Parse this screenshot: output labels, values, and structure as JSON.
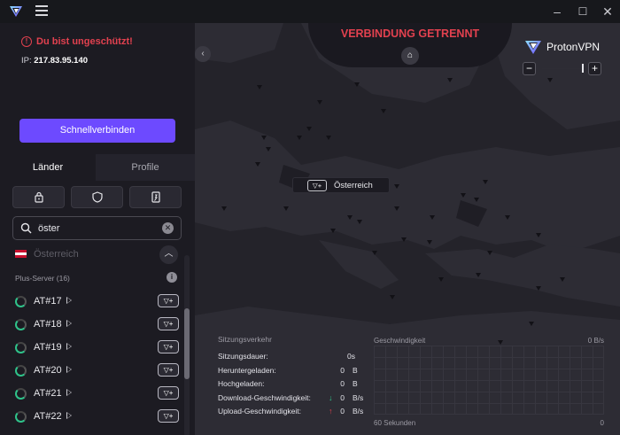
{
  "window": {
    "minimize": "–",
    "maximize": "☐",
    "close": "✕"
  },
  "status": {
    "text": "Du bist ungeschützt!",
    "ip_label": "IP:",
    "ip": "217.83.95.140",
    "color": "#e2414f"
  },
  "quick_connect": "Schnellverbinden",
  "tabs": [
    {
      "label": "Länder",
      "active": true
    },
    {
      "label": "Profile",
      "active": false
    }
  ],
  "filters": [
    "secure-core-filter-icon",
    "shield-filter-icon",
    "p2p-filter-icon"
  ],
  "search": {
    "value": "öster",
    "clear": "✕"
  },
  "country": {
    "name": "Österreich",
    "flag": [
      "#c8102e",
      "#ffffff",
      "#c8102e"
    ]
  },
  "plus_header": "Plus-Server (16)",
  "servers": [
    {
      "name": "AT#17",
      "badge": "▽+"
    },
    {
      "name": "AT#18",
      "badge": "▽+"
    },
    {
      "name": "AT#19",
      "badge": "▽+"
    },
    {
      "name": "AT#20",
      "badge": "▽+"
    },
    {
      "name": "AT#21",
      "badge": "▽+"
    },
    {
      "name": "AT#22",
      "badge": "▽+"
    }
  ],
  "map": {
    "banner": "VERBINDUNG GETRENNT",
    "brand": {
      "proton": "Proton",
      "vpn": "VPN"
    },
    "location_chip": {
      "badge": "▽+",
      "label": "Österreich"
    }
  },
  "session": {
    "title": "Sitzungsverkehr",
    "rows": [
      {
        "label": "Sitzungsdauer:",
        "value": "0s",
        "unit": ""
      },
      {
        "label": "Heruntergeladen:",
        "value": "0",
        "unit": "B"
      },
      {
        "label": "Hochgeladen:",
        "value": "0",
        "unit": "B"
      },
      {
        "label": "Download-Geschwindigkeit:",
        "value": "0",
        "unit": "B/s",
        "arrow": "↓",
        "arrow_color": "#2fc38a"
      },
      {
        "label": "Upload-Geschwindigkeit:",
        "value": "0",
        "unit": "B/s",
        "arrow": "↑",
        "arrow_color": "#e2414f"
      }
    ]
  },
  "speed": {
    "title": "Geschwindigkeit",
    "max": "0 B/s",
    "left": "60 Sekunden",
    "right": "0"
  },
  "colors": {
    "accent": "#6d4aff",
    "danger": "#e2414f",
    "success": "#2fc38a"
  }
}
